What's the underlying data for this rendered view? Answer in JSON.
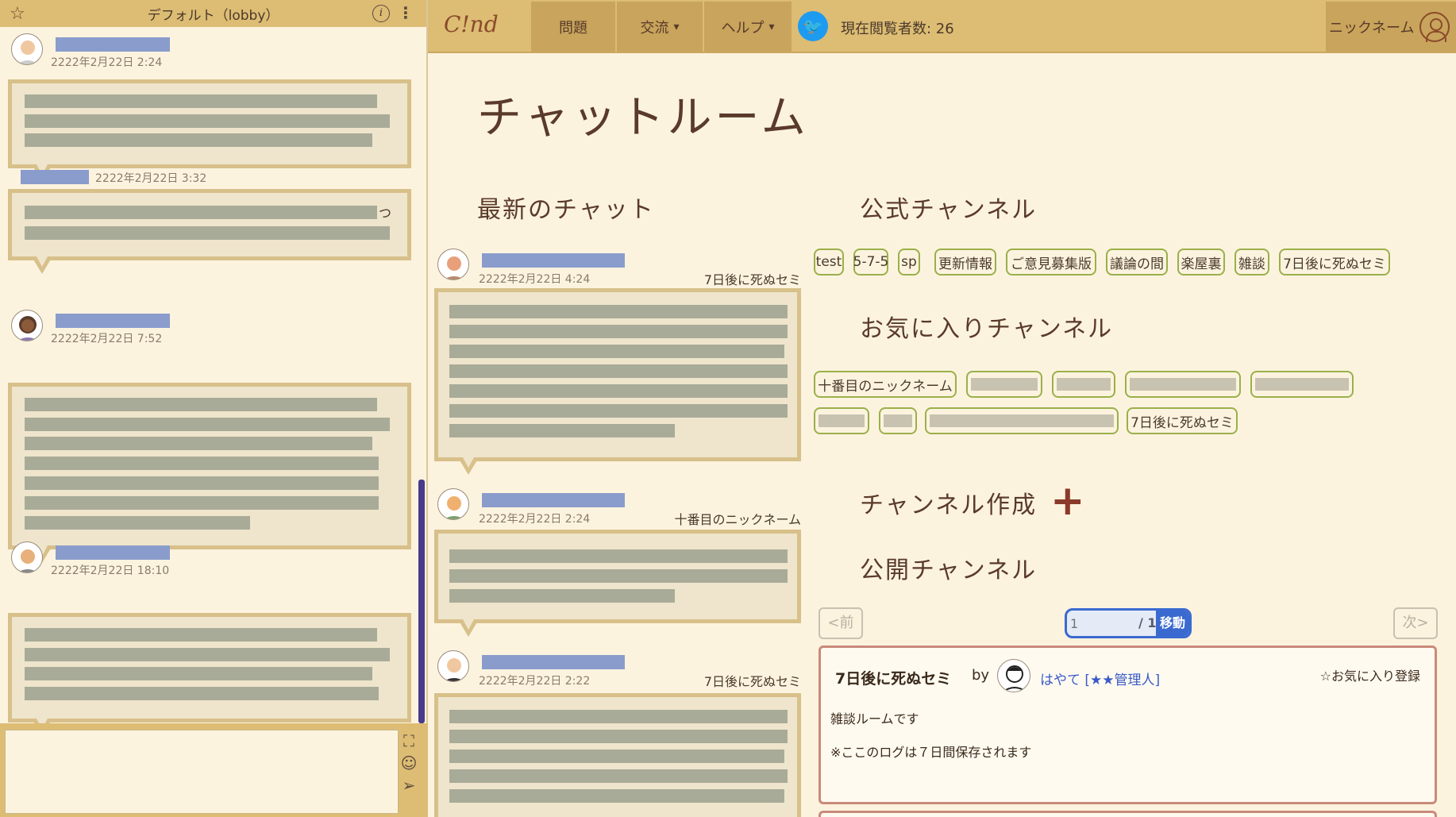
{
  "lobby": {
    "title": "デフォルト（lobby）",
    "info_icon": "i",
    "menu_icon": "⋮",
    "messages": [
      {
        "time": "2222年2月22日 2:24"
      },
      {
        "time": "2222年2月22日 3:32",
        "trailing_char": "つ"
      },
      {
        "time": "2222年2月22日 7:52"
      },
      {
        "time": "2222年2月22日 18:10"
      }
    ]
  },
  "nav": {
    "logo": "C!nd",
    "items": [
      {
        "label": "問題"
      },
      {
        "label": "交流",
        "dropdown": true
      },
      {
        "label": "ヘルプ",
        "dropdown": true
      }
    ],
    "viewers": "現在閲覧者数: 26",
    "user_label": "ニックネーム"
  },
  "main": {
    "page_title": "チャットルーム",
    "latest_heading": "最新のチャット",
    "latest": [
      {
        "time": "2222年2月22日 4:24",
        "channel": "7日後に死ぬセミ"
      },
      {
        "time": "2222年2月22日 2:24",
        "channel": "十番目のニックネーム"
      },
      {
        "time": "2222年2月22日 2:22",
        "channel": "7日後に死ぬセミ"
      }
    ],
    "official_heading": "公式チャンネル",
    "official_channels": [
      "test",
      "5-7-5",
      "sp",
      "更新情報",
      "ご意見募集版",
      "議論の間",
      "楽屋裏",
      "雑談",
      "7日後に死ぬセミ"
    ],
    "favorite_heading": "お気に入りチャンネル",
    "favorite_channels": [
      "十番目のニックネーム",
      "",
      "",
      "",
      "",
      "",
      "",
      "",
      "7日後に死ぬセミ"
    ],
    "create_heading": "チャンネル作成",
    "create_icon": "+",
    "public_heading": "公開チャンネル",
    "pager": {
      "prev": "<前",
      "next": "次>",
      "page_placeholder": "1",
      "of": "/ 1",
      "go": "移動"
    },
    "card": {
      "title": "7日後に死ぬセミ",
      "by": "by",
      "user": "はやて [★★管理人]",
      "fav": "☆お気に入り登録",
      "desc1": "雑談ルームです",
      "desc2": "※ここのログは７日間保存されます"
    }
  },
  "colors": {
    "header_bg": "#ddbc74",
    "nav_active": "#c8a45c",
    "bubble_border": "#d8c08a",
    "tag_border": "#9ab04a",
    "link_blue": "#3a5ac8",
    "plus_red": "#8a3a2a"
  }
}
